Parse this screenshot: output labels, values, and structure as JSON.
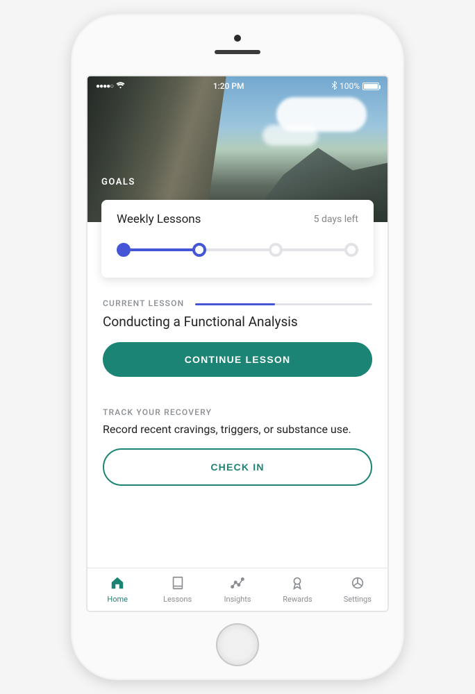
{
  "status_bar": {
    "signal": "●●●●○",
    "time": "1:20 PM",
    "battery_pct": "100%"
  },
  "hero": {
    "label": "GOALS"
  },
  "goals_card": {
    "title": "Weekly Lessons",
    "subtitle": "5 days left",
    "steps_total": 4,
    "steps_completed": 1,
    "steps_current_index": 1
  },
  "current_lesson": {
    "label": "CURRENT LESSON",
    "title": "Conducting a Functional Analysis",
    "progress_pct": 45,
    "button": "CONTINUE LESSON"
  },
  "recovery": {
    "label": "TRACK YOUR RECOVERY",
    "description": "Record recent cravings, triggers, or substance use.",
    "button": "CHECK IN"
  },
  "tabs": [
    {
      "id": "home",
      "label": "Home",
      "active": true
    },
    {
      "id": "lessons",
      "label": "Lessons",
      "active": false
    },
    {
      "id": "insights",
      "label": "Insights",
      "active": false
    },
    {
      "id": "rewards",
      "label": "Rewards",
      "active": false
    },
    {
      "id": "settings",
      "label": "Settings",
      "active": false
    }
  ],
  "colors": {
    "accent": "#1b8474",
    "progress": "#4455d6"
  }
}
